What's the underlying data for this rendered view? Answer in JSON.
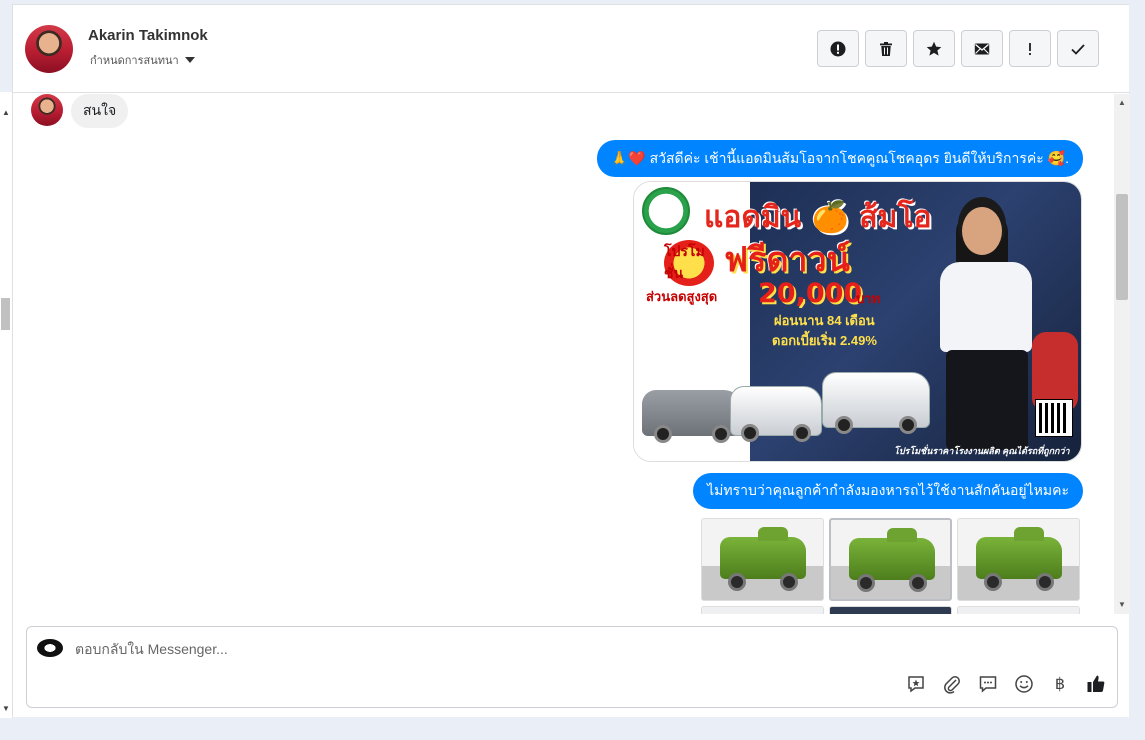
{
  "contact": {
    "name": "Akarin Takimnok",
    "assign_label": "กำหนดการสนทนา"
  },
  "toolbar": [
    {
      "name": "mark-spam-button",
      "icon": "alert-circle-icon"
    },
    {
      "name": "delete-button",
      "icon": "trash-icon"
    },
    {
      "name": "star-button",
      "icon": "star-icon"
    },
    {
      "name": "mark-unread-button",
      "icon": "envelope-icon"
    },
    {
      "name": "follow-up-button",
      "icon": "exclamation-icon"
    },
    {
      "name": "mark-done-button",
      "icon": "check-icon"
    }
  ],
  "messages": {
    "incoming_1": "สนใจ",
    "outgoing_1": {
      "emoji_prefix": "🙏❤️",
      "text": "สวัสดีค่ะ เช้านี้แอดมินส้มโอจากโชคคูณโชคอุดร ยินดีให้บริการค่ะ",
      "emoji_suffix": "🥰."
    },
    "outgoing_2": "ไม่ทราบว่าคุณลูกค้ากำลังมองหารถไว้ใช้งานสักคันอยู่ไหมคะ"
  },
  "promo": {
    "title": "แอดมิน 🍊 ส้มโอ",
    "badge": "โปรโมชั่น",
    "headline": "ฟรีดาวน์",
    "discount_label": "ส่วนลดสูงสุด",
    "discount_amount": "20,000",
    "currency": "บาท",
    "installment": "ผ่อนนาน 84 เดือน",
    "interest": "ดอกเบี้ยเริ่ม 2.49%",
    "footer": "โปรโมชั่นราคาโรงงานผลิต คุณได้รถที่ถูกกว่า"
  },
  "composer": {
    "placeholder": "ตอบกลับใน Messenger...",
    "tools": [
      "saved-reply-icon",
      "attachment-icon",
      "chat-bubble-icon",
      "emoji-icon",
      "baht-icon",
      "like-icon"
    ],
    "baht_glyph": "฿"
  }
}
